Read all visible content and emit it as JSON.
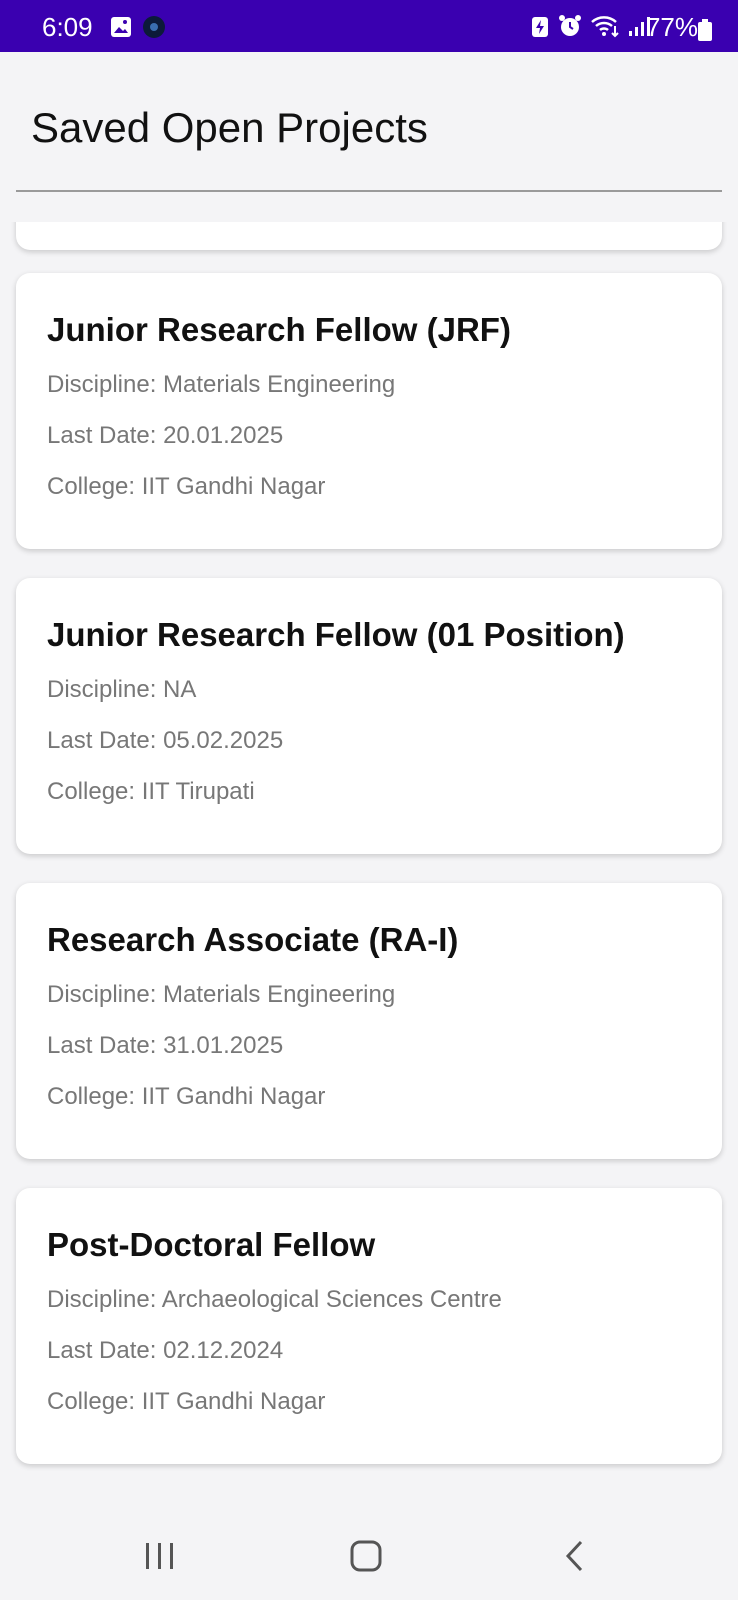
{
  "status": {
    "time": "6:09",
    "battery": "77%",
    "left_icons": [
      "image-icon",
      "app-notification-icon"
    ],
    "right_icons": [
      "battery-saver-icon",
      "alarm-icon",
      "wifi-icon",
      "signal-icon"
    ]
  },
  "header": {
    "title": "Saved Open Projects"
  },
  "projects": [
    {
      "title": "Junior Research Fellow (JRF)",
      "discipline": "Discipline: Materials Engineering",
      "last_date": "Last Date: 20.01.2025",
      "college": "College: IIT Gandhi Nagar"
    },
    {
      "title": "Junior Research Fellow (01 Position)",
      "discipline": "Discipline: NA",
      "last_date": "Last Date: 05.02.2025",
      "college": "College: IIT Tirupati"
    },
    {
      "title": "Research Associate (RA-I)",
      "discipline": "Discipline: Materials Engineering",
      "last_date": "Last Date: 31.01.2025",
      "college": "College: IIT Gandhi Nagar"
    },
    {
      "title": "Post-Doctoral Fellow",
      "discipline": "Discipline: Archaeological Sciences Centre",
      "last_date": "Last Date: 02.12.2024",
      "college": "College: IIT Gandhi Nagar"
    }
  ],
  "nav": {
    "buttons": [
      "recent-apps",
      "home",
      "back"
    ]
  },
  "colors": {
    "status_bar": "#3a00b0",
    "background": "#f4f4f6",
    "card": "#ffffff",
    "secondary_text": "#777777"
  }
}
